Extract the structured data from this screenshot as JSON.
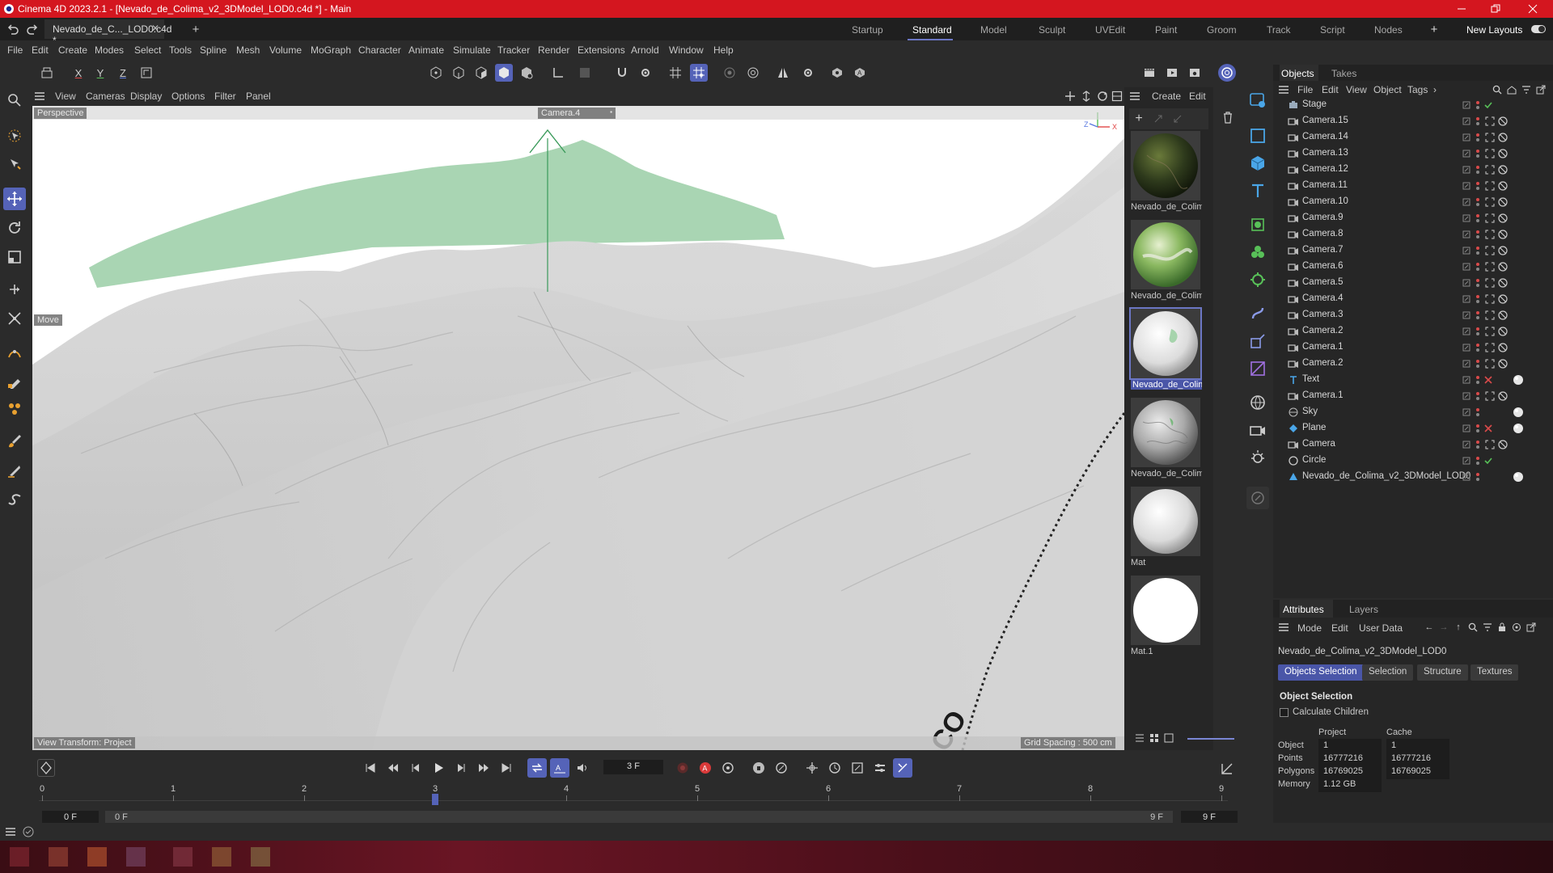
{
  "window": {
    "title": "Cinema 4D 2023.2.1 - [Nevado_de_Colima_v2_3DModel_LOD0.c4d *] - Main"
  },
  "tabs": {
    "document": "Nevado_de_C..._LOD0.c4d *",
    "layouts": [
      "Startup",
      "Standard",
      "Model",
      "Sculpt",
      "UVEdit",
      "Paint",
      "Groom",
      "Track",
      "Script",
      "Nodes"
    ],
    "active_layout": "Standard",
    "new_layouts": "New Layouts"
  },
  "menu": [
    "File",
    "Edit",
    "Create",
    "Modes",
    "Select",
    "Tools",
    "Spline",
    "Mesh",
    "Volume",
    "MoGraph",
    "Character",
    "Animate",
    "Simulate",
    "Tracker",
    "Render",
    "Extensions",
    "Arnold",
    "Window",
    "Help"
  ],
  "axis_toggles": [
    "X",
    "Y",
    "Z"
  ],
  "viewport": {
    "menu": [
      "View",
      "Cameras",
      "Display",
      "Options",
      "Filter",
      "Panel"
    ],
    "view_name": "Perspective",
    "camera": "Camera.4",
    "tool_label": "Move",
    "view_transform": "View Transform: Project",
    "grid_spacing": "Grid Spacing : 500 cm",
    "overlay_text": "CO"
  },
  "materials": {
    "menu": [
      "Create",
      "Edit"
    ],
    "items": [
      {
        "label": "Nevado_de_Colim",
        "selected": false
      },
      {
        "label": "Nevado_de_Colim",
        "selected": false
      },
      {
        "label": "Nevado_de_Colim",
        "selected": true
      },
      {
        "label": "Nevado_de_Colim",
        "selected": false
      },
      {
        "label": "Mat",
        "selected": false
      },
      {
        "label": "Mat.1",
        "selected": false
      }
    ]
  },
  "objects": {
    "tabs": [
      "Objects",
      "Takes"
    ],
    "menu": [
      "File",
      "Edit",
      "View",
      "Object",
      "Tags"
    ],
    "items": [
      {
        "name": "Stage",
        "icon": "stage"
      },
      {
        "name": "Camera.15",
        "icon": "camera"
      },
      {
        "name": "Camera.14",
        "icon": "camera"
      },
      {
        "name": "Camera.13",
        "icon": "camera"
      },
      {
        "name": "Camera.12",
        "icon": "camera"
      },
      {
        "name": "Camera.11",
        "icon": "camera"
      },
      {
        "name": "Camera.10",
        "icon": "camera"
      },
      {
        "name": "Camera.9",
        "icon": "camera"
      },
      {
        "name": "Camera.8",
        "icon": "camera"
      },
      {
        "name": "Camera.7",
        "icon": "camera"
      },
      {
        "name": "Camera.6",
        "icon": "camera"
      },
      {
        "name": "Camera.5",
        "icon": "camera"
      },
      {
        "name": "Camera.4",
        "icon": "camera"
      },
      {
        "name": "Camera.3",
        "icon": "camera"
      },
      {
        "name": "Camera.2",
        "icon": "camera"
      },
      {
        "name": "Camera.1",
        "icon": "camera"
      },
      {
        "name": "Camera.2",
        "icon": "camera"
      },
      {
        "name": "Text",
        "icon": "text"
      },
      {
        "name": "Camera.1",
        "icon": "camera"
      },
      {
        "name": "Sky",
        "icon": "sky"
      },
      {
        "name": "Plane",
        "icon": "plane"
      },
      {
        "name": "Camera",
        "icon": "camera"
      },
      {
        "name": "Circle",
        "icon": "circle"
      },
      {
        "name": "Nevado_de_Colima_v2_3DModel_LOD0",
        "icon": "mesh"
      }
    ]
  },
  "attributes": {
    "tabs": [
      "Attributes",
      "Layers"
    ],
    "menu": [
      "Mode",
      "Edit",
      "User Data"
    ],
    "object_name": "Nevado_de_Colima_v2_3DModel_LOD0",
    "sub_tabs": [
      "Objects Selection",
      "Selection",
      "Structure",
      "Textures"
    ],
    "active_sub_tab": "Objects Selection",
    "section": "Object Selection",
    "calculate_children": "Calculate Children",
    "col_project": "Project",
    "col_cache": "Cache",
    "rows": [
      {
        "label": "Object",
        "project": "1",
        "cache": "1"
      },
      {
        "label": "Points",
        "project": "16777216",
        "cache": "16777216"
      },
      {
        "label": "Polygons",
        "project": "16769025",
        "cache": "16769025"
      },
      {
        "label": "Memory",
        "project": "1.12 GB",
        "cache": ""
      }
    ]
  },
  "timeline": {
    "current_frame": "3 F",
    "start_frame": "0 F",
    "preview_start": "0 F",
    "preview_end": "9 F",
    "end_frame": "9 F",
    "ticks": [
      "0",
      "1",
      "2",
      "3",
      "4",
      "5",
      "6",
      "7",
      "8",
      "9"
    ],
    "playhead": 3,
    "max": 9
  }
}
